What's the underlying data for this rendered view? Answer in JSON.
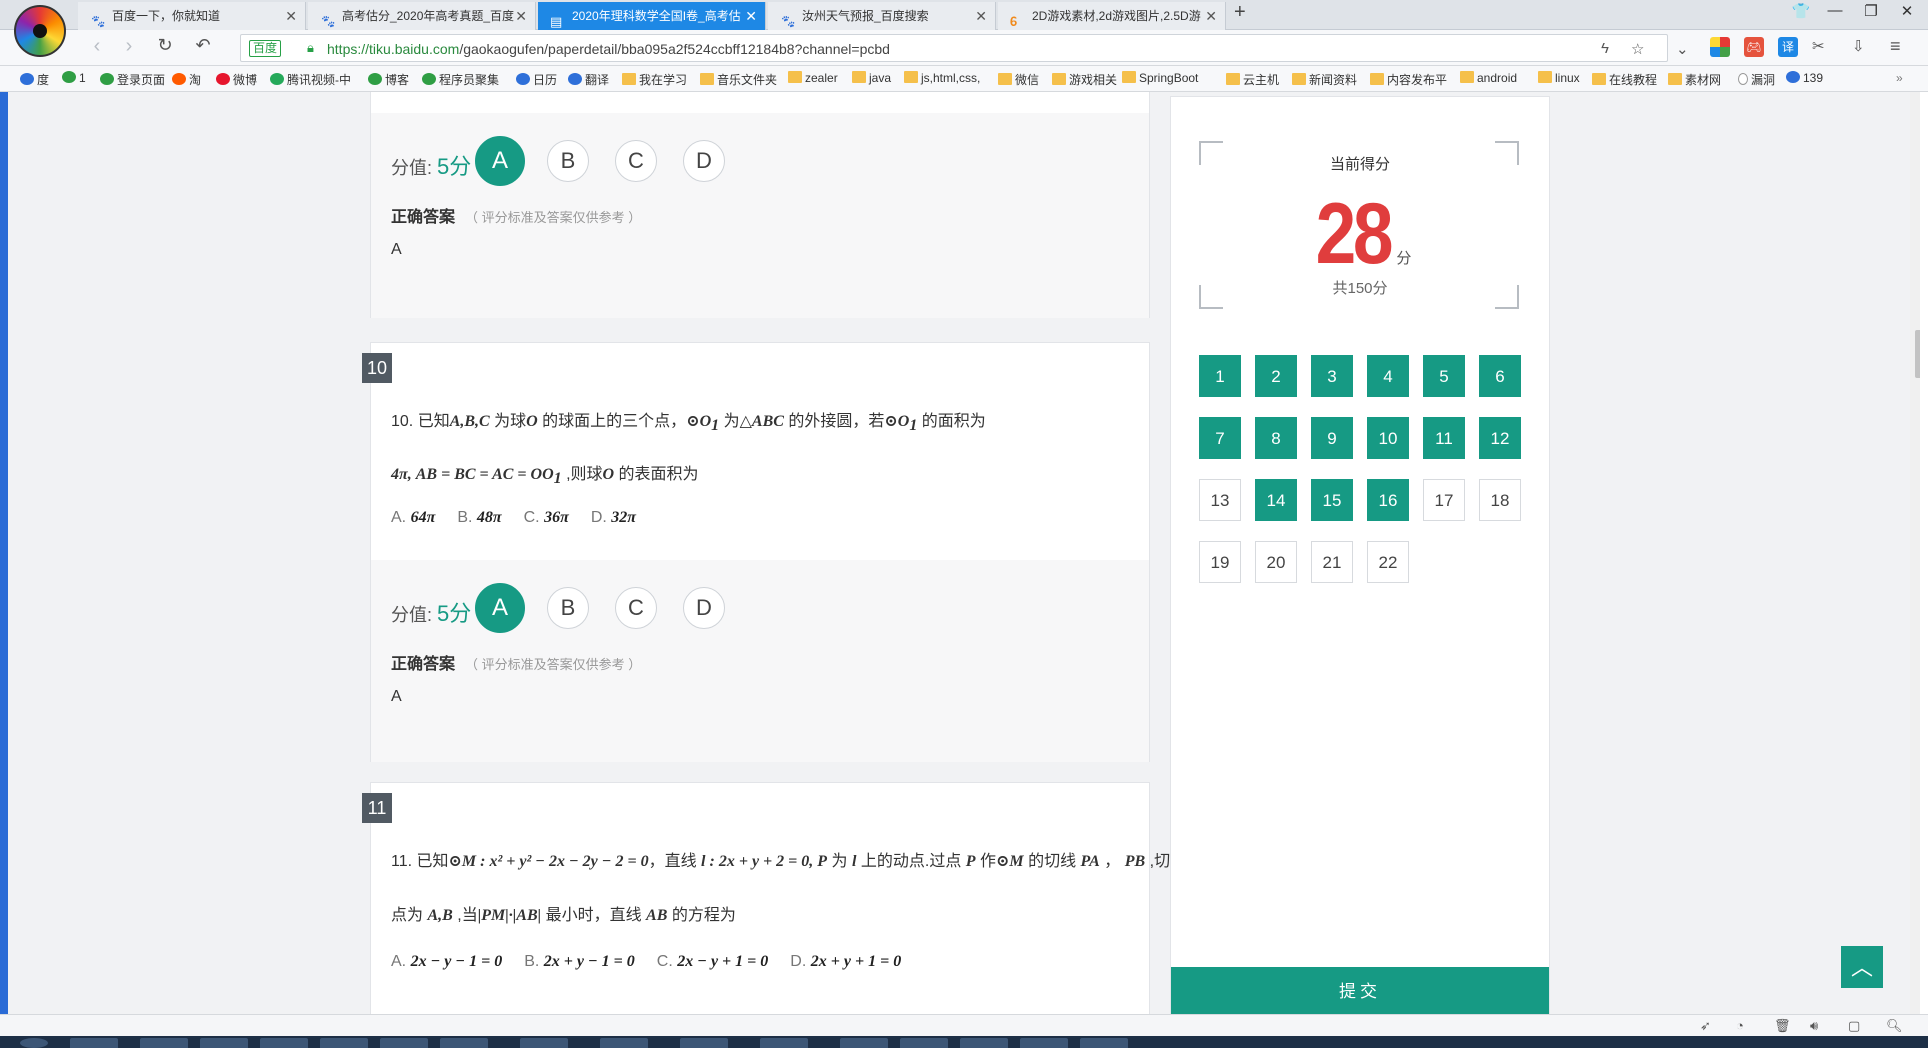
{
  "tabs": [
    {
      "label": "百度一下，你就知道",
      "icon": "paw-icon",
      "active": false
    },
    {
      "label": "高考估分_2020年高考真题_百度",
      "icon": "paw-icon",
      "active": false
    },
    {
      "label": "2020年理科数学全国I卷_高考估",
      "icon": "doc-icon",
      "active": true
    },
    {
      "label": "汝州天气预报_百度搜索",
      "icon": "paw-icon",
      "active": false
    },
    {
      "label": "2D游戏素材,2d游戏图片,2.5D游",
      "icon": "flame-icon",
      "active": false
    }
  ],
  "address": {
    "security_badge": "百度",
    "url_scheme": "https://",
    "url_host": "tiku.baidu.com",
    "url_path": "/gaokaogufen/paperdetail/bba095a2f524ccbff12184b8?channel=pcbd"
  },
  "bookmarks": [
    {
      "label": "度",
      "type": "fav",
      "color": "#2e6fd9"
    },
    {
      "label": "1",
      "type": "fav",
      "color": "#2f9e44"
    },
    {
      "label": "登录页面",
      "type": "fav",
      "color": "#2f9e44"
    },
    {
      "label": "淘",
      "type": "fav",
      "color": "#ff5a00"
    },
    {
      "label": "微博",
      "type": "fav",
      "color": "#e6162d"
    },
    {
      "label": "腾讯视频-中",
      "type": "fav",
      "color": "#25a95a"
    },
    {
      "label": "博客",
      "type": "fav",
      "color": "#2f9e44"
    },
    {
      "label": "程序员聚集",
      "type": "fav",
      "color": "#2f9e44"
    },
    {
      "label": "日历",
      "type": "fav",
      "color": "#2e6fd9"
    },
    {
      "label": "翻译",
      "type": "fav",
      "color": "#2e6fd9"
    },
    {
      "label": "我在学习",
      "type": "folder"
    },
    {
      "label": "音乐文件夹",
      "type": "folder"
    },
    {
      "label": "zealer",
      "type": "folder"
    },
    {
      "label": "java",
      "type": "folder"
    },
    {
      "label": "js,html,css,",
      "type": "folder"
    },
    {
      "label": "微信",
      "type": "folder"
    },
    {
      "label": "游戏相关",
      "type": "folder"
    },
    {
      "label": "SpringBoot",
      "type": "folder"
    },
    {
      "label": "云主机",
      "type": "folder"
    },
    {
      "label": "新闻资料",
      "type": "folder"
    },
    {
      "label": "内容发布平",
      "type": "folder"
    },
    {
      "label": "android",
      "type": "folder"
    },
    {
      "label": "linux",
      "type": "folder"
    },
    {
      "label": "在线教程",
      "type": "folder"
    },
    {
      "label": "素材网",
      "type": "folder"
    },
    {
      "label": "漏洞",
      "type": "page"
    },
    {
      "label": "139",
      "type": "fav",
      "color": "#2e6fd9"
    }
  ],
  "q9": {
    "score_label": "分值:",
    "score_value": "5分",
    "options": [
      "A",
      "B",
      "C",
      "D"
    ],
    "selected": "A",
    "answer_title": "正确答案",
    "answer_note": "（ 评分标准及答案仅供参考 ）",
    "answer_value": "A"
  },
  "q10": {
    "number": "10",
    "line1_prefix": "10. 已知",
    "line1_math1": "A,B,C",
    "line1_mid1": " 为球",
    "line1_math2": "O",
    "line1_mid2": " 的球面上的三个点，",
    "line1_math3": "⊙O",
    "line1_sub3": "1",
    "line1_mid3": " 为",
    "line1_math4": "△ABC",
    "line1_mid4": " 的外接圆，若",
    "line1_math5": "⊙O",
    "line1_sub5": "1",
    "line1_end": " 的面积为",
    "line2_math": "4π, AB = BC = AC = OO",
    "line2_sub": "1",
    "line2_mid": " ,则球",
    "line2_math2": "O",
    "line2_end": " 的表面积为",
    "choices": [
      {
        "letter": "A.",
        "value": "64π"
      },
      {
        "letter": "B.",
        "value": "48π"
      },
      {
        "letter": "C.",
        "value": "36π"
      },
      {
        "letter": "D.",
        "value": "32π"
      }
    ],
    "score_label": "分值:",
    "score_value": "5分",
    "options": [
      "A",
      "B",
      "C",
      "D"
    ],
    "selected": "A",
    "answer_title": "正确答案",
    "answer_note": "（ 评分标准及答案仅供参考 ）",
    "answer_value": "A"
  },
  "q11": {
    "number": "11",
    "line1_prefix": "11. 已知",
    "line1_math1": "⊙M : x² + y² − 2x − 2y − 2 = 0",
    "line1_mid1": "，直线 ",
    "line1_math2": "l : 2x + y + 2 = 0,",
    "line1_math3": " P",
    "line1_mid2": " 为 ",
    "line1_math4": "l",
    "line1_mid3": " 上的动点.过点 ",
    "line1_math5": "P",
    "line1_mid4": " 作",
    "line1_math6": "⊙M",
    "line1_mid5": " 的切线 ",
    "line1_math7": "PA",
    "line1_mid6": " ， ",
    "line1_math8": "PB",
    "line1_end": " ,切",
    "line2_prefix": "点为 ",
    "line2_math1": "A,B",
    "line2_mid1": " ,当",
    "line2_math2": "|PM|·|AB|",
    "line2_mid2": " 最小时，直线 ",
    "line2_math3": "AB",
    "line2_end": " 的方程为",
    "choices": [
      {
        "letter": "A.",
        "value": "2x − y − 1 = 0"
      },
      {
        "letter": "B.",
        "value": "2x + y − 1 = 0"
      },
      {
        "letter": "C.",
        "value": "2x − y + 1 = 0"
      },
      {
        "letter": "D.",
        "value": "2x + y + 1 = 0"
      }
    ]
  },
  "panel": {
    "score_label": "当前得分",
    "score": "28",
    "score_unit": "分",
    "total": "共150分",
    "questions": [
      {
        "n": "1",
        "done": true
      },
      {
        "n": "2",
        "done": true
      },
      {
        "n": "3",
        "done": true
      },
      {
        "n": "4",
        "done": true
      },
      {
        "n": "5",
        "done": true
      },
      {
        "n": "6",
        "done": true
      },
      {
        "n": "7",
        "done": true
      },
      {
        "n": "8",
        "done": true
      },
      {
        "n": "9",
        "done": true
      },
      {
        "n": "10",
        "done": true
      },
      {
        "n": "11",
        "done": true
      },
      {
        "n": "12",
        "done": true
      },
      {
        "n": "13",
        "done": false
      },
      {
        "n": "14",
        "done": true
      },
      {
        "n": "15",
        "done": true
      },
      {
        "n": "16",
        "done": true
      },
      {
        "n": "17",
        "done": false
      },
      {
        "n": "18",
        "done": false
      },
      {
        "n": "19",
        "done": false
      },
      {
        "n": "20",
        "done": false
      },
      {
        "n": "21",
        "done": false
      },
      {
        "n": "22",
        "done": false
      }
    ],
    "submit_label": "提交"
  },
  "colors": {
    "accent": "#169a84",
    "score_red": "#e03d3d",
    "tab_active": "#1e88e5"
  }
}
